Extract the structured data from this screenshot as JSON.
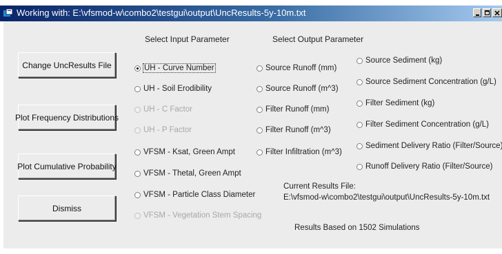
{
  "window": {
    "title": "Working with: E:\\vfsmod-w\\combo2\\testgui\\output\\UncResults-5y-10m.txt",
    "colors": {
      "titlebar_start": "#0a246a",
      "titlebar_end": "#a6caf0",
      "client_bg": "#ececec"
    }
  },
  "buttons": {
    "change": "Change  UncResults File",
    "freq": "Plot Frequency Distributions",
    "cumulative": "Plot Cumulative Probability",
    "dismiss": "Dismiss"
  },
  "input_section": {
    "header": "Select Input Parameter",
    "options": [
      {
        "label": "UH - Curve Number",
        "selected": true,
        "enabled": true
      },
      {
        "label": "UH - Soil Erodibility",
        "selected": false,
        "enabled": true
      },
      {
        "label": "UH - C Factor",
        "selected": false,
        "enabled": false
      },
      {
        "label": "UH - P Factor",
        "selected": false,
        "enabled": false
      },
      {
        "label": "VFSM - Ksat, Green Ampt",
        "selected": false,
        "enabled": true
      },
      {
        "label": "VFSM - Thetal, Green Ampt",
        "selected": false,
        "enabled": true
      },
      {
        "label": "VFSM - Particle Class Diameter",
        "selected": false,
        "enabled": true
      },
      {
        "label": "VFSM - Vegetation Stem Spacing",
        "selected": false,
        "enabled": false
      }
    ]
  },
  "output_section": {
    "header": "Select Output Parameter",
    "col1": [
      {
        "label": "Source Runoff (mm)"
      },
      {
        "label": "Source Runoff (m^3)"
      },
      {
        "label": "Filter Runoff (mm)"
      },
      {
        "label": "Filter Runoff (m^3)"
      },
      {
        "label": "Filter Infiltration (m^3)"
      }
    ],
    "col2": [
      {
        "label": "Source Sediment (kg)"
      },
      {
        "label": "Source Sediment Concentration  (g/L)"
      },
      {
        "label": "Filter Sediment (kg)"
      },
      {
        "label": "Filter Sediment Concentration (g/L)"
      },
      {
        "label": "Sediment Delivery Ratio (Filter/Source)"
      },
      {
        "label": "Runoff Delivery Ratio (Filter/Source)"
      }
    ]
  },
  "results": {
    "file_label": "Current Results File:",
    "file_path": "E:\\vfsmod-w\\combo2\\testgui\\output\\UncResults-5y-10m.txt",
    "summary": "Results Based on  1502 Simulations"
  }
}
